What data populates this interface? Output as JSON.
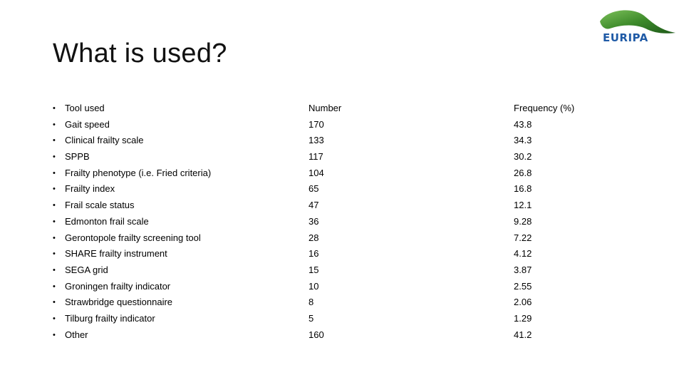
{
  "slide": {
    "title": "What is used?",
    "logo_text": "EURIPA",
    "logo_colors": {
      "leaf": "#3d8a2a",
      "text": "#1f5aa6"
    },
    "bullet": "•",
    "headers": {
      "tool": "Tool used",
      "number": "Number",
      "frequency": "Frequency (%)"
    },
    "rows": [
      {
        "tool": "Gait speed",
        "number": "170",
        "frequency": "43.8"
      },
      {
        "tool": "Clinical frailty scale",
        "number": "133",
        "frequency": "34.3"
      },
      {
        "tool": "SPPB",
        "number": "117",
        "frequency": "30.2"
      },
      {
        "tool": "Frailty phenotype (i.e. Fried criteria)",
        "number": "104",
        "frequency": "26.8"
      },
      {
        "tool": "Frailty index",
        "number": "65",
        "frequency": "16.8"
      },
      {
        "tool": "Frail scale status",
        "number": "47",
        "frequency": "12.1"
      },
      {
        "tool": "Edmonton frail scale",
        "number": "36",
        "frequency": "9.28"
      },
      {
        "tool": "Gerontopole frailty screening tool",
        "number": "28",
        "frequency": "7.22"
      },
      {
        "tool": "SHARE frailty instrument",
        "number": "16",
        "frequency": "4.12"
      },
      {
        "tool": "SEGA grid",
        "number": "15",
        "frequency": "3.87"
      },
      {
        "tool": "Groningen frailty indicator",
        "number": "10",
        "frequency": "2.55"
      },
      {
        "tool": "Strawbridge questionnaire",
        "number": "8",
        "frequency": "2.06"
      },
      {
        "tool": "Tilburg frailty indicator",
        "number": "5",
        "frequency": "1.29"
      },
      {
        "tool": "Other",
        "number": "160",
        "frequency": "41.2"
      }
    ]
  }
}
